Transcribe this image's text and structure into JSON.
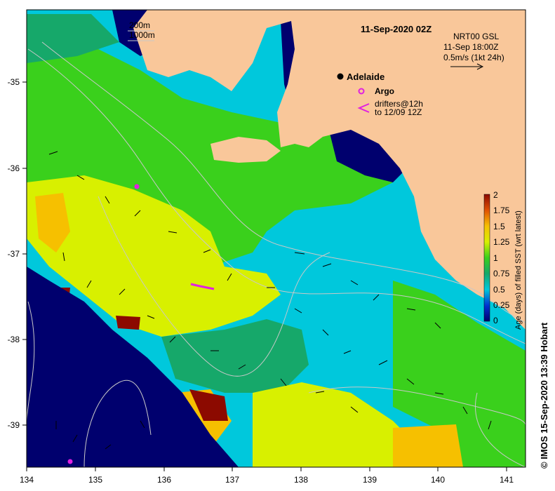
{
  "title": "11-Sep-2020 02Z",
  "current_info": {
    "line1": "NRT00 GSL",
    "line2": "11-Sep 18:00Z",
    "line3": "0.5m/s (1kt 24h)"
  },
  "contour_legend": {
    "a": "200m",
    "b": "1000m"
  },
  "places": {
    "adelaide": "Adelaide",
    "argo": "Argo",
    "drifters_line1": "drifters@12h",
    "drifters_line2": "to 12/09 12Z"
  },
  "x_ticks": [
    "134",
    "135",
    "136",
    "137",
    "138",
    "139",
    "140",
    "141"
  ],
  "y_ticks": [
    "-35",
    "-36",
    "-37",
    "-38",
    "-39"
  ],
  "colorbar": {
    "label": "Age (days) of filled SST (wrt latest)",
    "ticks": [
      "2",
      "1.75",
      "1.5",
      "1.25",
      "1",
      "0.75",
      "0.5",
      "0.25",
      "0"
    ]
  },
  "credit": "© IMOS 15-Sep-2020 13:39 Hobart",
  "colors": {
    "land": "#f9c79a",
    "age_0": "#00006e",
    "age_0_5": "#00c8dc",
    "age_0_75": "#16a86a",
    "age_1": "#3ad01c",
    "age_1_25": "#d8f000",
    "age_1_5": "#f6c000",
    "age_2": "#8c0a00",
    "argo": "#e020e0"
  }
}
